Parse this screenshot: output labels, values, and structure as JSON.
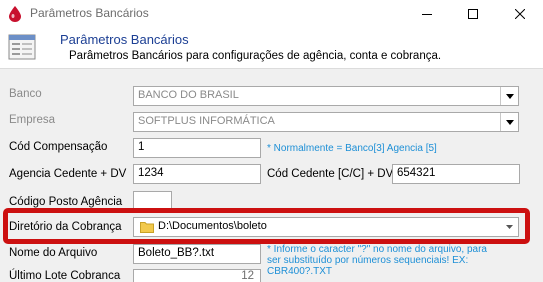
{
  "window": {
    "title": "Parâmetros Bancários"
  },
  "banner": {
    "title": "Parâmetros Bancários",
    "subtitle": "Parâmetros Bancários para configurações de agência, conta e cobrança."
  },
  "form": {
    "banco": {
      "label": "Banco",
      "value": "BANCO DO BRASIL"
    },
    "empresa": {
      "label": "Empresa",
      "value": "SOFTPLUS INFORMÁTICA"
    },
    "cod_compensacao": {
      "label": "Cód Compensação",
      "value": "1",
      "hint": "* Normalmente  = Banco[3] Agencia [5]"
    },
    "agencia_cedente": {
      "label": "Agencia Cedente + DV",
      "value": "1234"
    },
    "cod_cedente": {
      "label": "Cód Cedente [C/C] + DV",
      "value": "654321"
    },
    "codigo_posto": {
      "label": "Código Posto Agência",
      "value": ""
    },
    "diretorio_cobranca": {
      "label": "Diretório da Cobrança",
      "value": "D:\\Documentos\\boleto"
    },
    "nome_arquivo": {
      "label": "Nome do Arquivo",
      "value": "Boleto_BB?.txt",
      "hint_line1": "* Informe o caracter \"?\" no nome do arquivo, para",
      "hint_line2": "ser substituído por números sequenciais! EX:",
      "hint_line3": "CBR400?.TXT"
    },
    "ultimo_lote": {
      "label": "Último Lote Cobranca",
      "value": "12"
    }
  },
  "colors": {
    "accent_title": "#1c3f94",
    "hint_blue": "#1d8fd6",
    "highlight_red": "#cc1010",
    "app_icon_red": "#c8102e"
  },
  "icons": {
    "app": "bank-drop-icon",
    "banner": "form-document-icon",
    "folder": "folder-icon"
  }
}
